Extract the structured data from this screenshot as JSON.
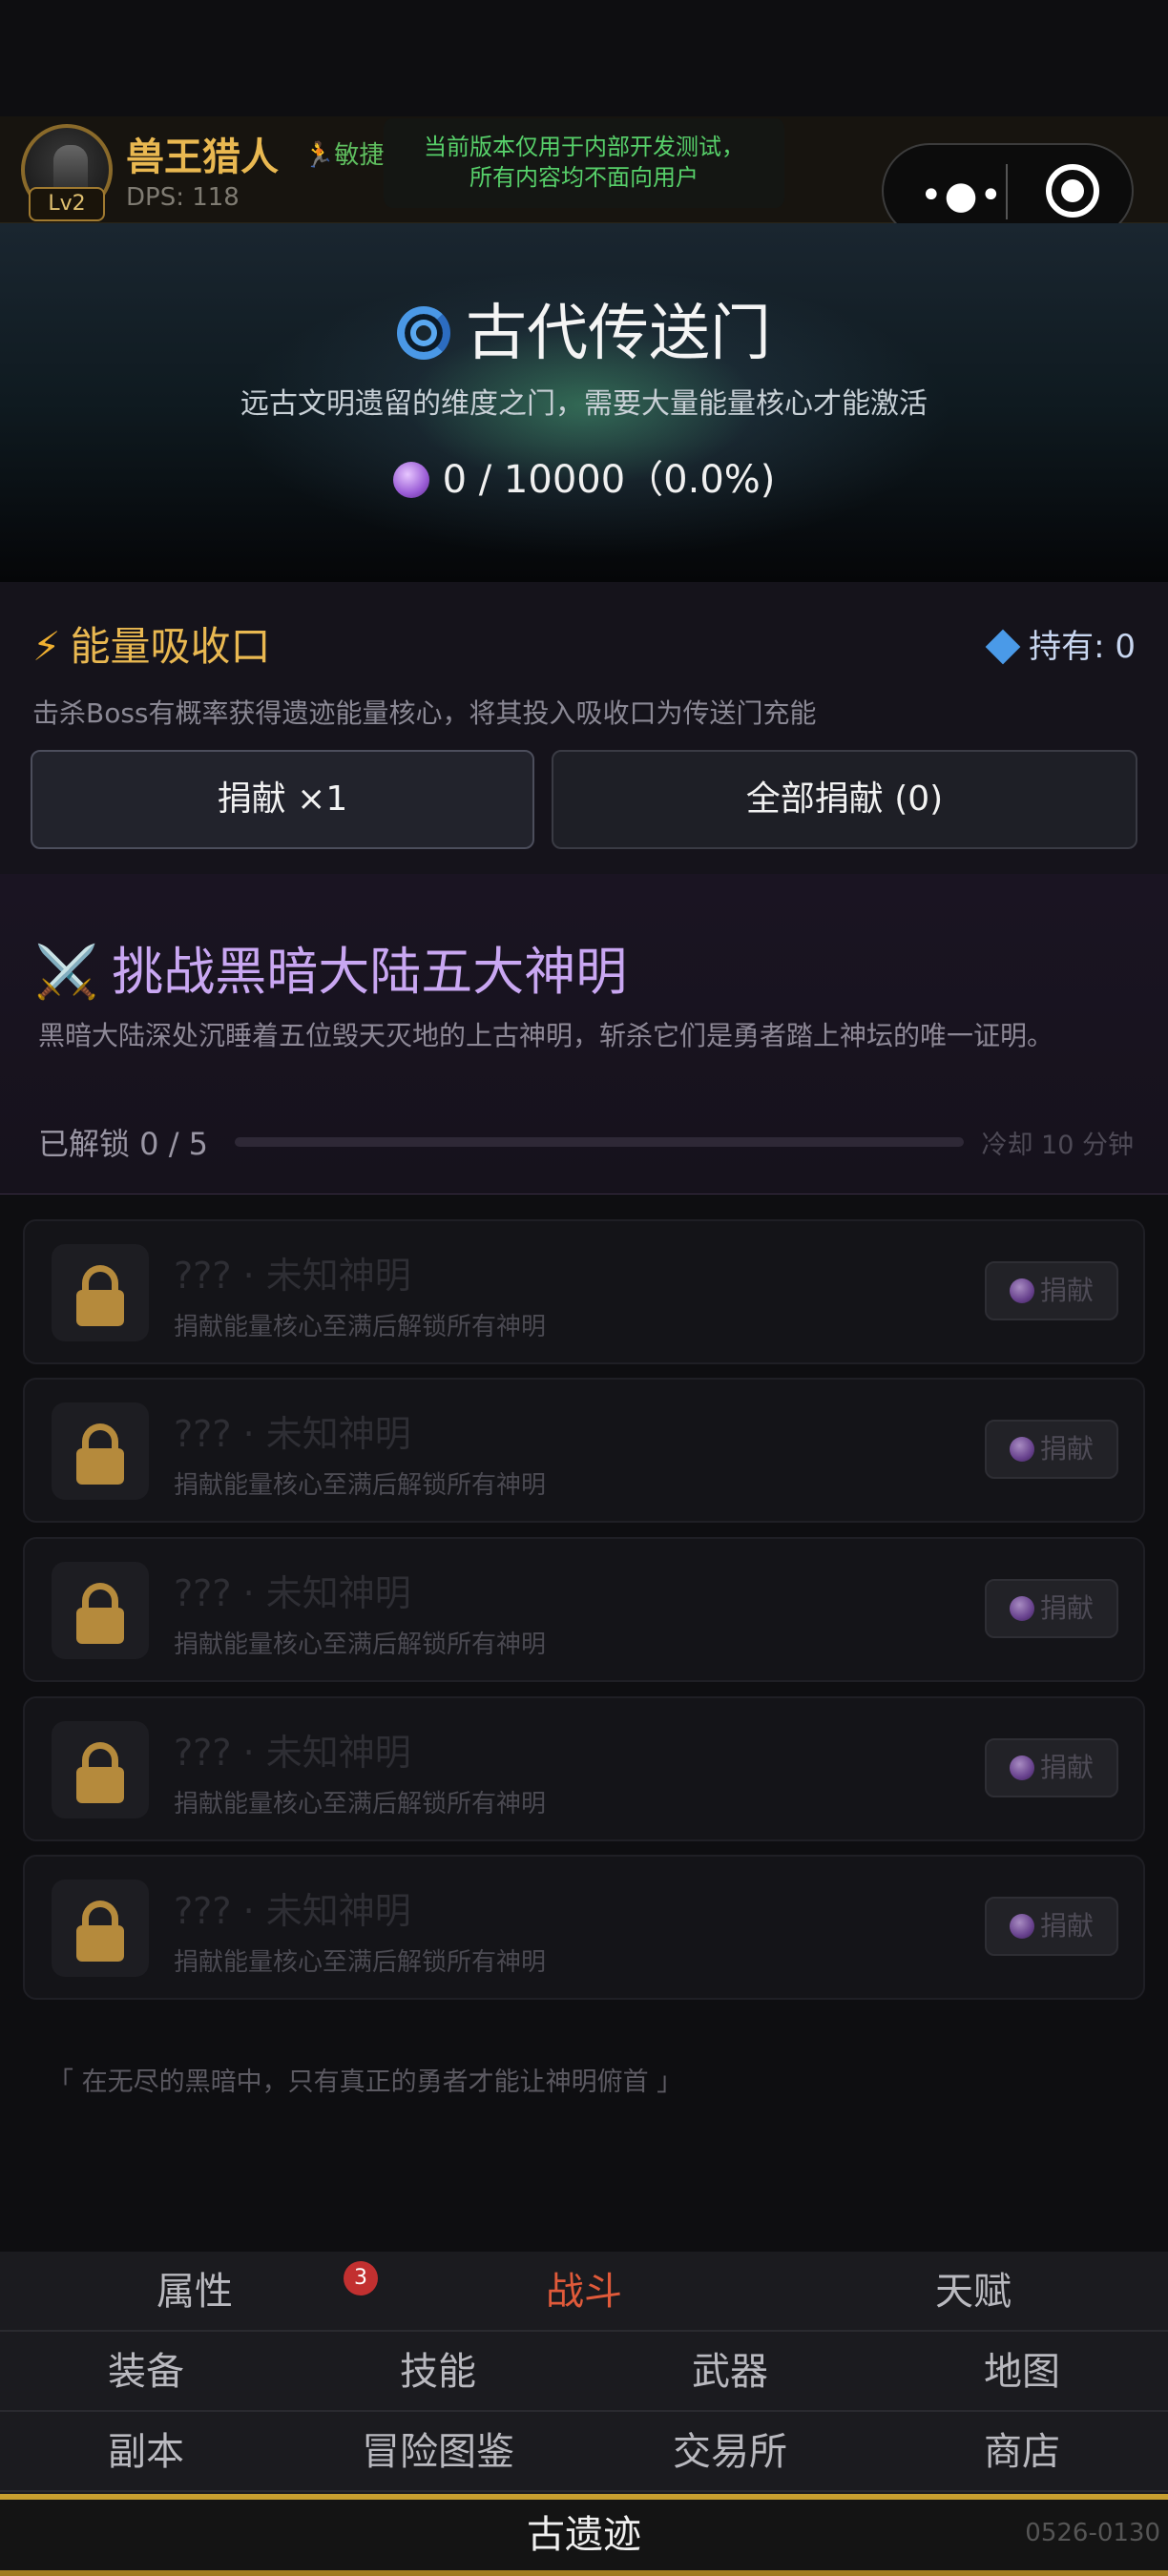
{
  "player": {
    "name": "兽王猎人",
    "class_icon": "running-figure-icon",
    "class_name": "敏捷",
    "level": "Lv2",
    "dps": "DPS: 118"
  },
  "dev_notice": {
    "line1": "当前版本仅用于内部开发测试，",
    "line2": "所有内容均不面向用户"
  },
  "capsule": {
    "menu_icon": "more-dots-icon",
    "close_icon": "target-icon"
  },
  "banner": {
    "title": "古代传送门",
    "subtitle": "远古文明遗留的维度之门，需要大量能量核心才能激活",
    "progress": "0 / 10000（0.0%)"
  },
  "energy": {
    "title": "能量吸收口",
    "held": "持有: 0",
    "description": "击杀Boss有概率获得遗迹能量核心，将其投入吸收口为传送门充能",
    "donate_one": "捐献 ×1",
    "donate_all": "全部捐献 (0)"
  },
  "gods": {
    "title": "挑战黑暗大陆五大神明",
    "description": "黑暗大陆深处沉睡着五位毁天灭地的上古神明，斩杀它们是勇者踏上神坛的唯一证明。",
    "unlocked": "已解锁 0 / 5",
    "unlock_fraction": 0,
    "cooldown": "冷却 10 分钟",
    "cards": [
      {
        "name": "??? · 未知神明",
        "desc": "捐献能量核心至满后解锁所有神明",
        "button": "捐献"
      },
      {
        "name": "??? · 未知神明",
        "desc": "捐献能量核心至满后解锁所有神明",
        "button": "捐献"
      },
      {
        "name": "??? · 未知神明",
        "desc": "捐献能量核心至满后解锁所有神明",
        "button": "捐献"
      },
      {
        "name": "??? · 未知神明",
        "desc": "捐献能量核心至满后解锁所有神明",
        "button": "捐献"
      },
      {
        "name": "??? · 未知神明",
        "desc": "捐献能量核心至满后解锁所有神明",
        "button": "捐献"
      }
    ]
  },
  "quote": "「 在无尽的黑暗中，只有真正的勇者才能让神明俯首 」",
  "nav": {
    "row1": [
      "属性",
      "战斗",
      "天赋"
    ],
    "row1_badge": "3",
    "row2": [
      "装备",
      "技能",
      "武器",
      "地图"
    ],
    "row3": [
      "副本",
      "冒险图鉴",
      "交易所",
      "商店"
    ],
    "current": "古遗迹",
    "active_color": "#e05a3a"
  },
  "version": "0526-0130"
}
